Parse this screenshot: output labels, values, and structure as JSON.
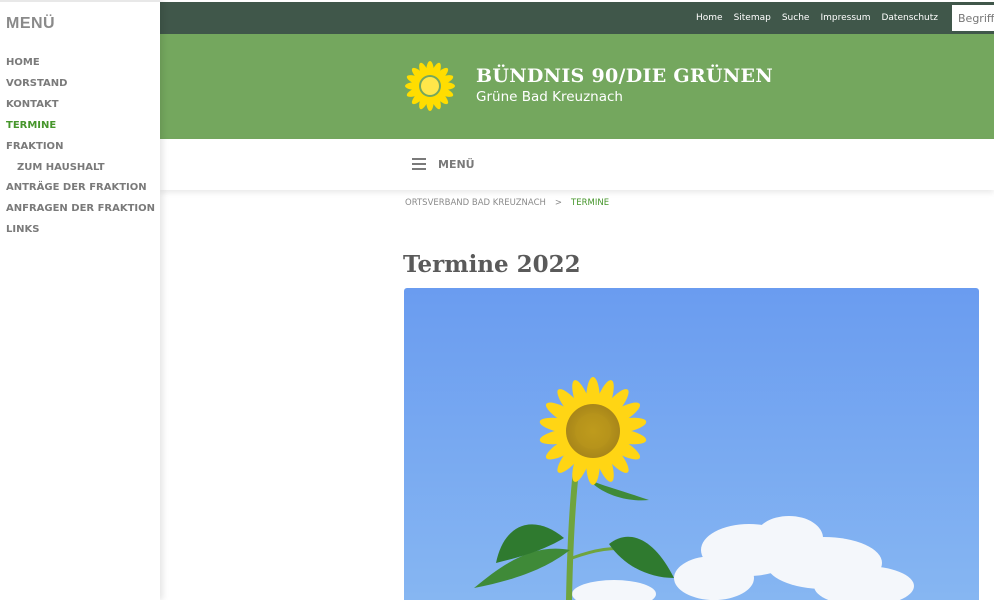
{
  "sidebar": {
    "title": "MENÜ",
    "items": [
      {
        "label": "HOME"
      },
      {
        "label": "VORSTAND"
      },
      {
        "label": "KONTAKT"
      },
      {
        "label": "TERMINE",
        "active": true
      },
      {
        "label": "FRAKTION"
      },
      {
        "label": "ZUM HAUSHALT",
        "sub": true
      },
      {
        "label": "ANTRÄGE DER FRAKTION"
      },
      {
        "label": "ANFRAGEN DER FRAKTION"
      },
      {
        "label": "LINKS"
      }
    ]
  },
  "topbar": {
    "links": [
      "Home",
      "Sitemap",
      "Suche",
      "Impressum",
      "Datenschutz"
    ],
    "search_placeholder": "Begriff eingeben"
  },
  "header": {
    "site_name": "BÜNDNIS 90/DIE GRÜNEN",
    "site_subtitle": "Grüne Bad Kreuznach",
    "logo_icon": "sunflower-icon"
  },
  "menubar": {
    "label": "MENÜ",
    "icon": "hamburger-icon"
  },
  "breadcrumb": {
    "parent": "ORTSVERBAND BAD KREUZNACH",
    "separator": ">",
    "current": "TERMINE"
  },
  "main": {
    "title": "Termine 2022"
  },
  "colors": {
    "topbar": "#40574a",
    "header": "#74a75e",
    "accent": "#46962b",
    "sky": "#6c9ff0"
  }
}
